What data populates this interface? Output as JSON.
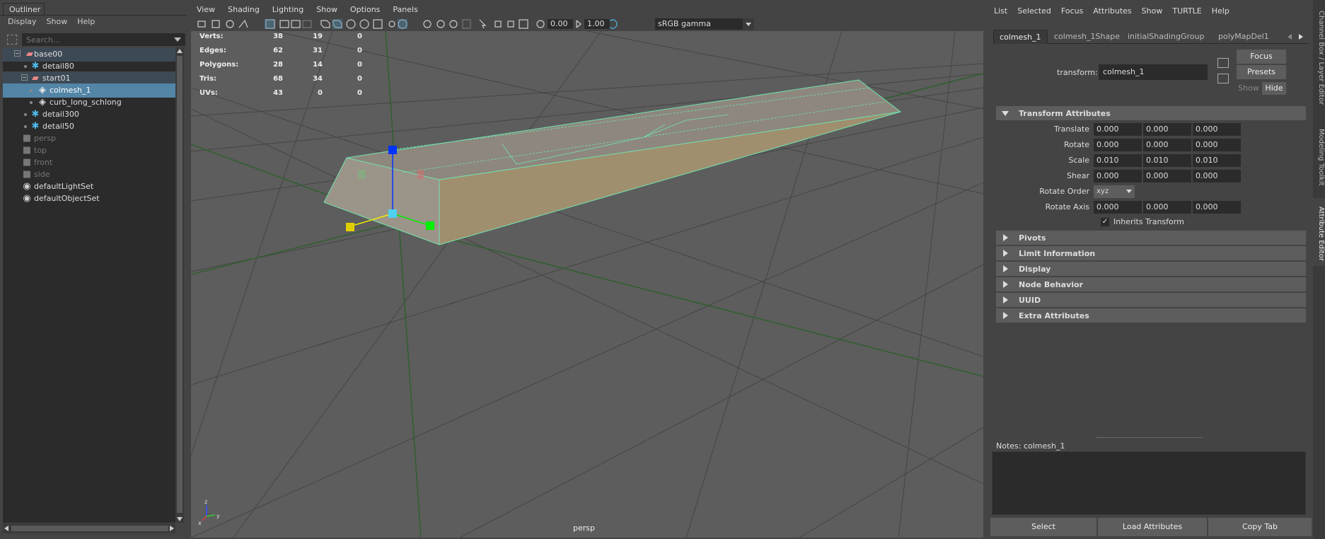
{
  "outliner": {
    "tab": "Outliner",
    "menu": [
      "Display",
      "Show",
      "Help"
    ],
    "search_placeholder": "Search...",
    "items": [
      {
        "label": "base00"
      },
      {
        "label": "detail80"
      },
      {
        "label": "start01"
      },
      {
        "label": "colmesh_1"
      },
      {
        "label": "curb_long_schlong"
      },
      {
        "label": "detail300"
      },
      {
        "label": "detail50"
      },
      {
        "label": "persp"
      },
      {
        "label": "top"
      },
      {
        "label": "front"
      },
      {
        "label": "side"
      },
      {
        "label": "defaultLightSet"
      },
      {
        "label": "defaultObjectSet"
      }
    ]
  },
  "viewport": {
    "menu": [
      "View",
      "Shading",
      "Lighting",
      "Show",
      "Options",
      "Panels"
    ],
    "exposure": "0.00",
    "gamma": "1.00",
    "color_space": "sRGB gamma",
    "hud": [
      {
        "k": "Verts:",
        "v1": "38",
        "v2": "19",
        "v3": "0"
      },
      {
        "k": "Edges:",
        "v1": "62",
        "v2": "31",
        "v3": "0"
      },
      {
        "k": "Polygons:",
        "v1": "28",
        "v2": "14",
        "v3": "0"
      },
      {
        "k": "Tris:",
        "v1": "68",
        "v2": "34",
        "v3": "0"
      },
      {
        "k": "UVs:",
        "v1": "43",
        "v2": "0",
        "v3": "0"
      }
    ],
    "camera": "persp",
    "colors": {
      "canvas": "#5d5d5d",
      "selection": "#6fe3b0",
      "mesh_face": "#a89a78"
    }
  },
  "attr_editor": {
    "menu": [
      "List",
      "Selected",
      "Focus",
      "Attributes",
      "Show",
      "TURTLE",
      "Help"
    ],
    "tabs": [
      "colmesh_1",
      "colmesh_1Shape",
      "initialShadingGroup",
      "polyMapDel1"
    ],
    "transform_label": "transform:",
    "transform_value": "colmesh_1",
    "focus_btn": "Focus",
    "presets_btn": "Presets",
    "show_btn": "Show",
    "hide_btn": "Hide",
    "section_transform": "Transform Attributes",
    "rows": {
      "translate": {
        "name": "Translate",
        "x": "0.000",
        "y": "0.000",
        "z": "0.000"
      },
      "rotate": {
        "name": "Rotate",
        "x": "0.000",
        "y": "0.000",
        "z": "0.000"
      },
      "scale": {
        "name": "Scale",
        "x": "0.010",
        "y": "0.010",
        "z": "0.010"
      },
      "shear": {
        "name": "Shear",
        "x": "0.000",
        "y": "0.000",
        "z": "0.000"
      },
      "rotate_order": {
        "name": "Rotate Order",
        "value": "xyz"
      },
      "rotate_axis": {
        "name": "Rotate Axis",
        "x": "0.000",
        "y": "0.000",
        "z": "0.000"
      }
    },
    "inherits_transform": "Inherits Transform",
    "sections": [
      "Pivots",
      "Limit Information",
      "Display",
      "Node Behavior",
      "UUID",
      "Extra Attributes"
    ],
    "notes_label": "Notes:  colmesh_1",
    "bottom": {
      "select": "Select",
      "load": "Load Attributes",
      "copy": "Copy Tab"
    }
  },
  "side_tabs": [
    "Channel Box / Layer Editor",
    "Modeling Toolkit",
    "Attribute Editor"
  ]
}
